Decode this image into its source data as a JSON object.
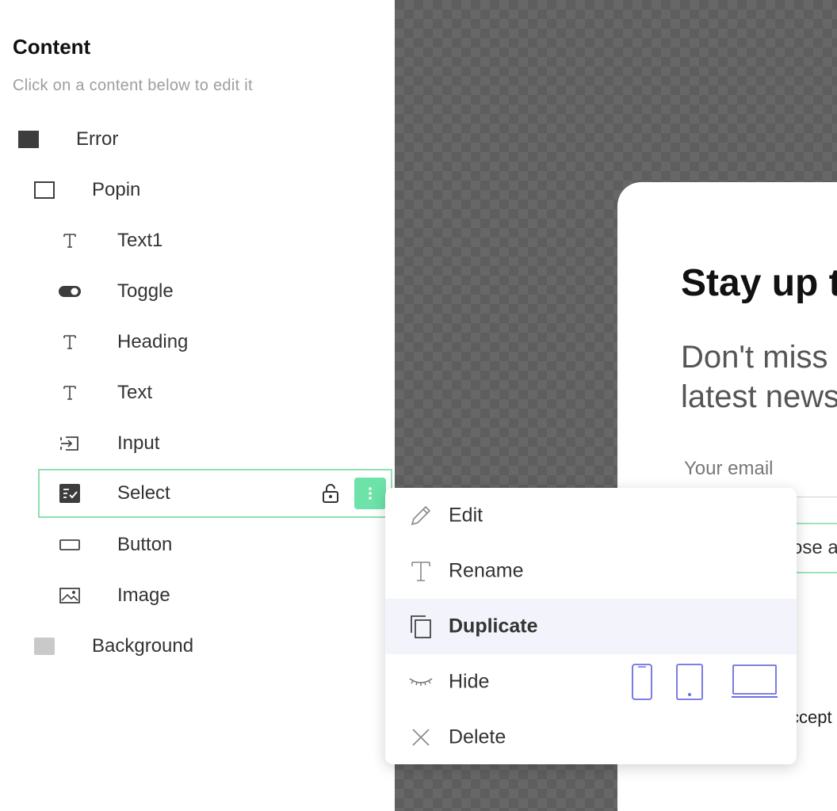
{
  "panel": {
    "title": "Content",
    "subtitle": "Click on a content below to edit it",
    "items": [
      {
        "label": "Error",
        "icon": "filled-square-icon"
      },
      {
        "label": "Popin",
        "icon": "outline-square-icon"
      },
      {
        "label": "Text1",
        "icon": "text-icon"
      },
      {
        "label": "Toggle",
        "icon": "toggle-icon"
      },
      {
        "label": "Heading",
        "icon": "text-icon"
      },
      {
        "label": "Text",
        "icon": "text-icon"
      },
      {
        "label": "Input",
        "icon": "input-icon"
      },
      {
        "label": "Select",
        "icon": "select-icon"
      },
      {
        "label": "Button",
        "icon": "button-icon"
      },
      {
        "label": "Image",
        "icon": "image-icon"
      },
      {
        "label": "Background",
        "icon": "background-swatch-icon"
      }
    ]
  },
  "preview": {
    "heading": "Stay up t",
    "text": "Don't miss\nlatest news",
    "input_label": "Your email",
    "select_text": "ose a",
    "accept_text": "ccept"
  },
  "menu": {
    "items": [
      {
        "label": "Edit",
        "icon": "pencil-icon"
      },
      {
        "label": "Rename",
        "icon": "text-icon"
      },
      {
        "label": "Duplicate",
        "icon": "duplicate-icon"
      },
      {
        "label": "Hide",
        "icon": "eye-closed-icon"
      },
      {
        "label": "Delete",
        "icon": "close-icon"
      }
    ],
    "hide_devices": [
      "mobile-icon",
      "tablet-icon",
      "desktop-icon"
    ]
  },
  "colors": {
    "accent": "#6de3a9",
    "accent_border": "#8ee0b0",
    "device_icon": "#6b6fe0",
    "menu_active_bg": "#f2f3fb"
  }
}
